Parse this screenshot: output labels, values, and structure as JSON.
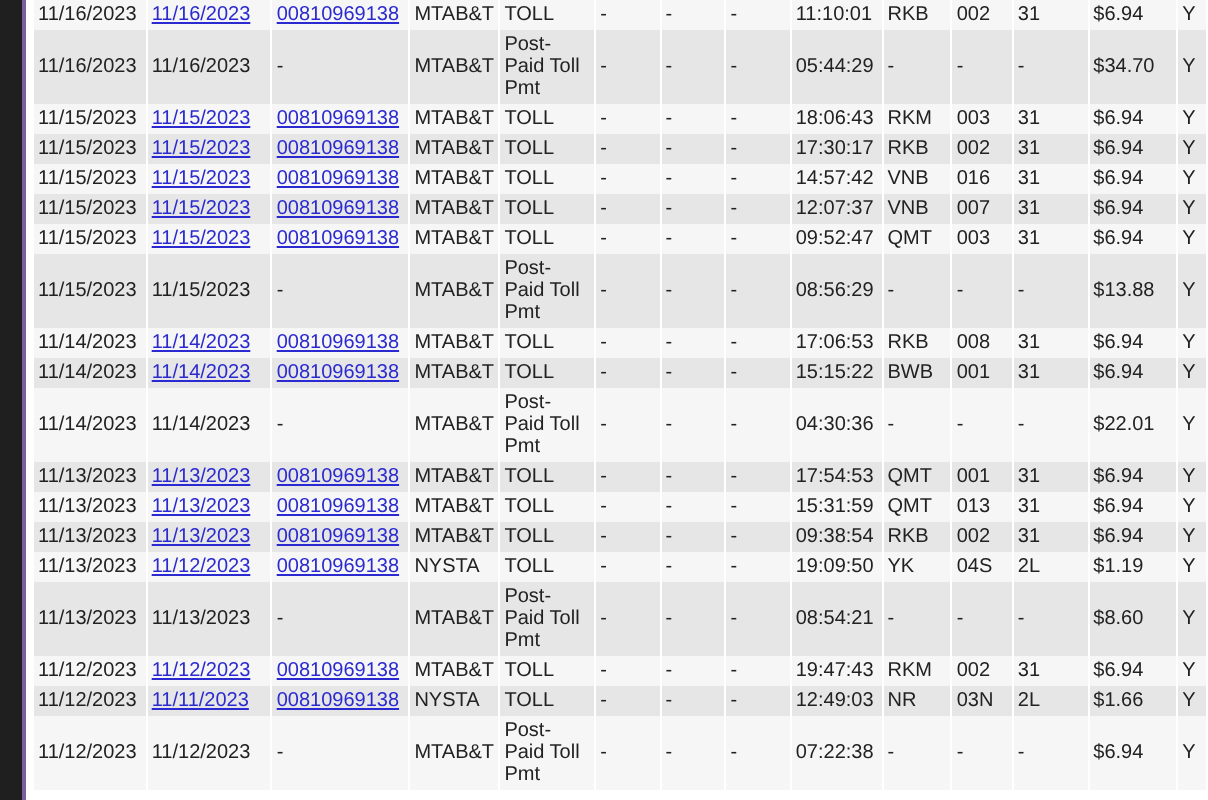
{
  "table": {
    "rows": [
      {
        "kind": "toll",
        "cells": [
          "11/16/2023",
          "11/16/2023",
          "00810969138",
          "MTAB&T",
          "TOLL",
          "-",
          "-",
          "-",
          "11:10:01",
          "RKB",
          "002",
          "31",
          "$6.94",
          "Y"
        ]
      },
      {
        "kind": "payment",
        "cells": [
          "11/16/2023",
          "11/16/2023",
          "-",
          "MTAB&T",
          "Post-Paid Toll Pmt",
          "-",
          "-",
          "-",
          "05:44:29",
          "-",
          "-",
          "-",
          "$34.70",
          "Y"
        ]
      },
      {
        "kind": "toll",
        "cells": [
          "11/15/2023",
          "11/15/2023",
          "00810969138",
          "MTAB&T",
          "TOLL",
          "-",
          "-",
          "-",
          "18:06:43",
          "RKM",
          "003",
          "31",
          "$6.94",
          "Y"
        ]
      },
      {
        "kind": "toll",
        "cells": [
          "11/15/2023",
          "11/15/2023",
          "00810969138",
          "MTAB&T",
          "TOLL",
          "-",
          "-",
          "-",
          "17:30:17",
          "RKB",
          "002",
          "31",
          "$6.94",
          "Y"
        ]
      },
      {
        "kind": "toll",
        "cells": [
          "11/15/2023",
          "11/15/2023",
          "00810969138",
          "MTAB&T",
          "TOLL",
          "-",
          "-",
          "-",
          "14:57:42",
          "VNB",
          "016",
          "31",
          "$6.94",
          "Y"
        ]
      },
      {
        "kind": "toll",
        "cells": [
          "11/15/2023",
          "11/15/2023",
          "00810969138",
          "MTAB&T",
          "TOLL",
          "-",
          "-",
          "-",
          "12:07:37",
          "VNB",
          "007",
          "31",
          "$6.94",
          "Y"
        ]
      },
      {
        "kind": "toll",
        "cells": [
          "11/15/2023",
          "11/15/2023",
          "00810969138",
          "MTAB&T",
          "TOLL",
          "-",
          "-",
          "-",
          "09:52:47",
          "QMT",
          "003",
          "31",
          "$6.94",
          "Y"
        ]
      },
      {
        "kind": "payment",
        "cells": [
          "11/15/2023",
          "11/15/2023",
          "-",
          "MTAB&T",
          "Post-Paid Toll Pmt",
          "-",
          "-",
          "-",
          "08:56:29",
          "-",
          "-",
          "-",
          "$13.88",
          "Y"
        ]
      },
      {
        "kind": "toll",
        "cells": [
          "11/14/2023",
          "11/14/2023",
          "00810969138",
          "MTAB&T",
          "TOLL",
          "-",
          "-",
          "-",
          "17:06:53",
          "RKB",
          "008",
          "31",
          "$6.94",
          "Y"
        ]
      },
      {
        "kind": "toll",
        "cells": [
          "11/14/2023",
          "11/14/2023",
          "00810969138",
          "MTAB&T",
          "TOLL",
          "-",
          "-",
          "-",
          "15:15:22",
          "BWB",
          "001",
          "31",
          "$6.94",
          "Y"
        ]
      },
      {
        "kind": "payment",
        "cells": [
          "11/14/2023",
          "11/14/2023",
          "-",
          "MTAB&T",
          "Post-Paid Toll Pmt",
          "-",
          "-",
          "-",
          "04:30:36",
          "-",
          "-",
          "-",
          "$22.01",
          "Y"
        ]
      },
      {
        "kind": "toll",
        "cells": [
          "11/13/2023",
          "11/13/2023",
          "00810969138",
          "MTAB&T",
          "TOLL",
          "-",
          "-",
          "-",
          "17:54:53",
          "QMT",
          "001",
          "31",
          "$6.94",
          "Y"
        ]
      },
      {
        "kind": "toll",
        "cells": [
          "11/13/2023",
          "11/13/2023",
          "00810969138",
          "MTAB&T",
          "TOLL",
          "-",
          "-",
          "-",
          "15:31:59",
          "QMT",
          "013",
          "31",
          "$6.94",
          "Y"
        ]
      },
      {
        "kind": "toll",
        "cells": [
          "11/13/2023",
          "11/13/2023",
          "00810969138",
          "MTAB&T",
          "TOLL",
          "-",
          "-",
          "-",
          "09:38:54",
          "RKB",
          "002",
          "31",
          "$6.94",
          "Y"
        ]
      },
      {
        "kind": "toll",
        "cells": [
          "11/13/2023",
          "11/12/2023",
          "00810969138",
          "NYSTA",
          "TOLL",
          "-",
          "-",
          "-",
          "19:09:50",
          "YK",
          "04S",
          "2L",
          "$1.19",
          "Y"
        ]
      },
      {
        "kind": "payment",
        "cells": [
          "11/13/2023",
          "11/13/2023",
          "-",
          "MTAB&T",
          "Post-Paid Toll Pmt",
          "-",
          "-",
          "-",
          "08:54:21",
          "-",
          "-",
          "-",
          "$8.60",
          "Y"
        ]
      },
      {
        "kind": "toll",
        "cells": [
          "11/12/2023",
          "11/12/2023",
          "00810969138",
          "MTAB&T",
          "TOLL",
          "-",
          "-",
          "-",
          "19:47:43",
          "RKM",
          "002",
          "31",
          "$6.94",
          "Y"
        ]
      },
      {
        "kind": "toll",
        "cells": [
          "11/12/2023",
          "11/11/2023",
          "00810969138",
          "NYSTA",
          "TOLL",
          "-",
          "-",
          "-",
          "12:49:03",
          "NR",
          "03N",
          "2L",
          "$1.66",
          "Y"
        ]
      },
      {
        "kind": "payment",
        "cells": [
          "11/12/2023",
          "11/12/2023",
          "-",
          "MTAB&T",
          "Post-Paid Toll Pmt",
          "-",
          "-",
          "-",
          "07:22:38",
          "-",
          "-",
          "-",
          "$6.94",
          "Y"
        ]
      }
    ]
  }
}
